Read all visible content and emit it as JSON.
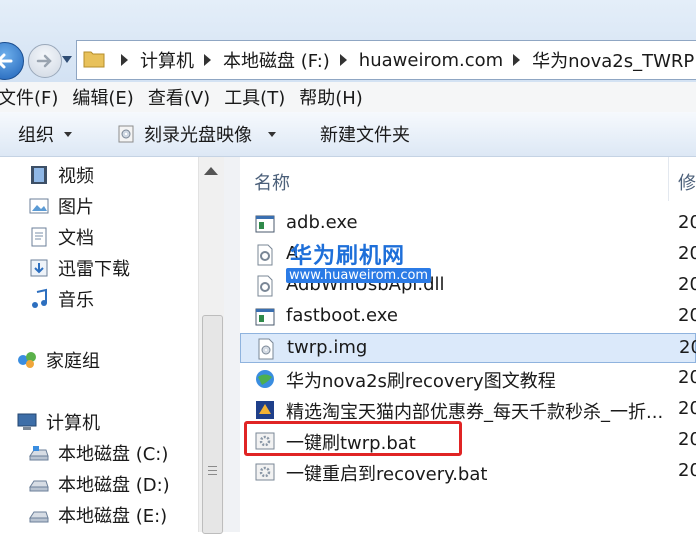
{
  "address": {
    "crumbs": [
      "计算机",
      "本地磁盘 (F:)",
      "huaweirom.com",
      "华为nova2s_TWRP"
    ]
  },
  "menu": [
    "文件(F)",
    "编辑(E)",
    "查看(V)",
    "工具(T)",
    "帮助(H)"
  ],
  "toolbar": {
    "organize": "组织",
    "burn": "刻录光盘映像",
    "new_folder": "新建文件夹"
  },
  "nav": {
    "items": [
      "视频",
      "图片",
      "文档",
      "迅雷下载",
      "音乐"
    ],
    "homegroup": "家庭组",
    "computer": "计算机",
    "drives": [
      "本地磁盘 (C:)",
      "本地磁盘 (D:)",
      "本地磁盘 (E:)"
    ]
  },
  "columns": {
    "name": "名称",
    "modified": "修"
  },
  "files": [
    {
      "name": "adb.exe",
      "date": "20"
    },
    {
      "name": "A",
      "date": "20"
    },
    {
      "name": "AdbWinUsbApi.dll",
      "date": "20"
    },
    {
      "name": "fastboot.exe",
      "date": "20"
    },
    {
      "name": "twrp.img",
      "date": "20"
    },
    {
      "name": "华为nova2s刷recovery图文教程",
      "date": "20"
    },
    {
      "name": "精选淘宝天猫内部优惠券_每天千款秒杀_一折...",
      "date": "20"
    },
    {
      "name": "一键刷twrp.bat",
      "date": "20"
    },
    {
      "name": "一键重启到recovery.bat",
      "date": "20"
    }
  ],
  "watermark": {
    "title": "华为刷机网",
    "url": "www.huaweirom.com"
  },
  "colors": {
    "accent": "#1f62b8",
    "highlight": "#e02424",
    "selection": "#dbe9fa"
  }
}
